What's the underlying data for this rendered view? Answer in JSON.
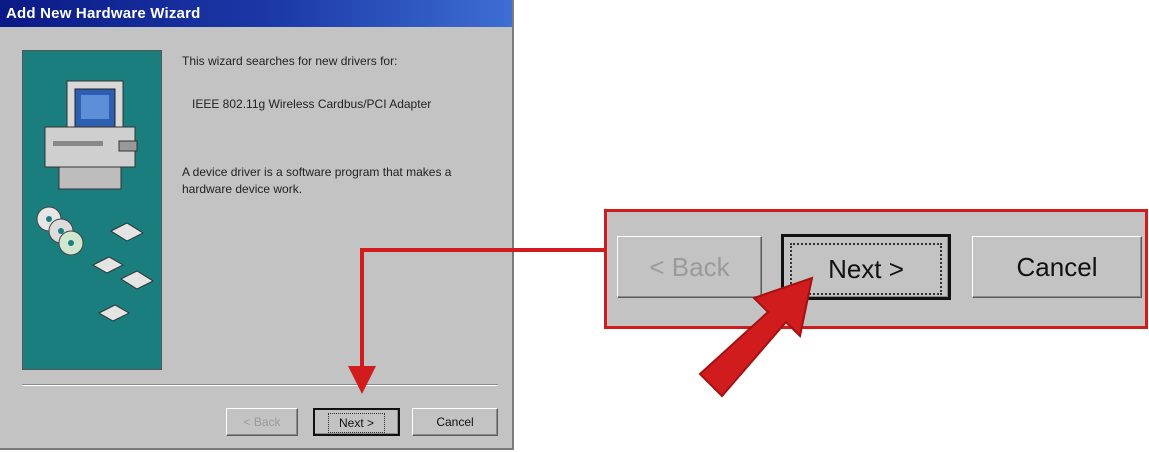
{
  "window": {
    "title": "Add New Hardware Wizard"
  },
  "content": {
    "intro": "This wizard searches for new drivers for:",
    "device_name": "IEEE 802.11g Wireless Cardbus/PCI Adapter",
    "description": "A device driver is a software program that makes a hardware device work."
  },
  "buttons": {
    "back": "< Back",
    "next": "Next >",
    "cancel": "Cancel"
  },
  "zoom": {
    "back": "< Back",
    "next": "Next >",
    "cancel": "Cancel"
  },
  "colors": {
    "title_bar": "#0a1a86",
    "side_panel": "#1a7e7e",
    "dialog_bg": "#c3c3c3",
    "annotation_red": "#d01c1c"
  },
  "icons": [
    "computer-icon",
    "cd-disc-icon",
    "floppy-disk-icon"
  ]
}
